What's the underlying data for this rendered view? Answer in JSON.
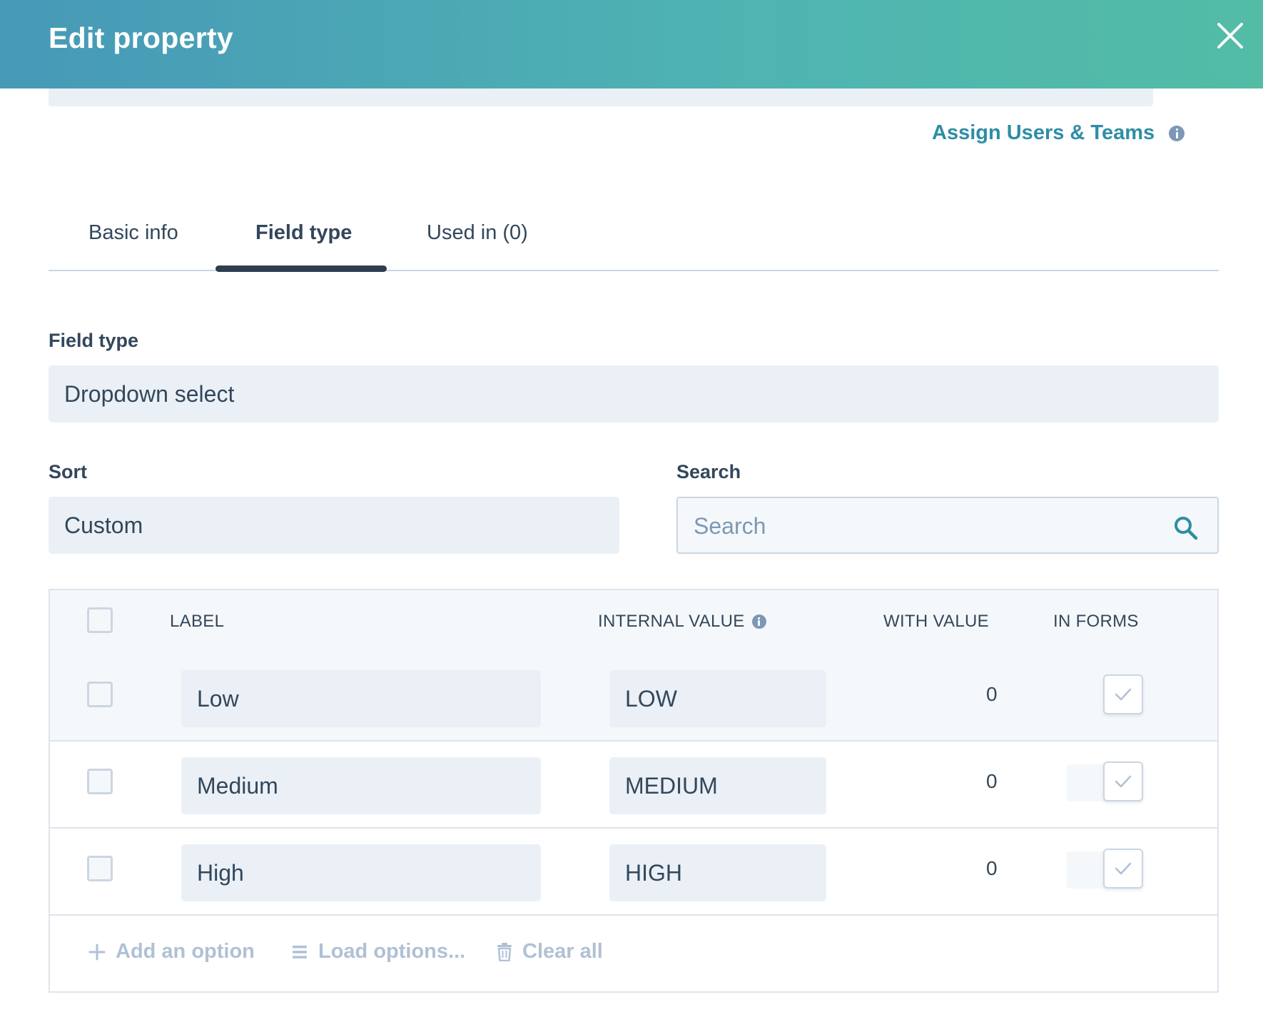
{
  "header": {
    "title": "Edit property"
  },
  "access": {
    "assign_link": "Assign Users & Teams"
  },
  "tabs": [
    {
      "label": "Basic info",
      "active": false
    },
    {
      "label": "Field type",
      "active": true
    },
    {
      "label": "Used in (0)",
      "active": false
    }
  ],
  "field_type": {
    "label": "Field type",
    "value": "Dropdown select"
  },
  "sort": {
    "label": "Sort",
    "value": "Custom"
  },
  "search": {
    "label": "Search",
    "placeholder": "Search"
  },
  "table": {
    "columns": {
      "label": "LABEL",
      "internal_value": "INTERNAL VALUE",
      "with_value": "WITH VALUE",
      "in_forms": "IN FORMS"
    },
    "rows": [
      {
        "label": "Low",
        "internal_value": "LOW",
        "with_value": "0",
        "in_forms": true
      },
      {
        "label": "Medium",
        "internal_value": "MEDIUM",
        "with_value": "0",
        "in_forms": true
      },
      {
        "label": "High",
        "internal_value": "HIGH",
        "with_value": "0",
        "in_forms": true
      }
    ],
    "actions": {
      "add": "Add an option",
      "load": "Load options...",
      "clear": "Clear all"
    }
  },
  "colors": {
    "header_start": "#4799b7",
    "header_end": "#53bca5",
    "link": "#2d8ea5",
    "text": "#33475b",
    "muted": "#b0c1d4"
  }
}
